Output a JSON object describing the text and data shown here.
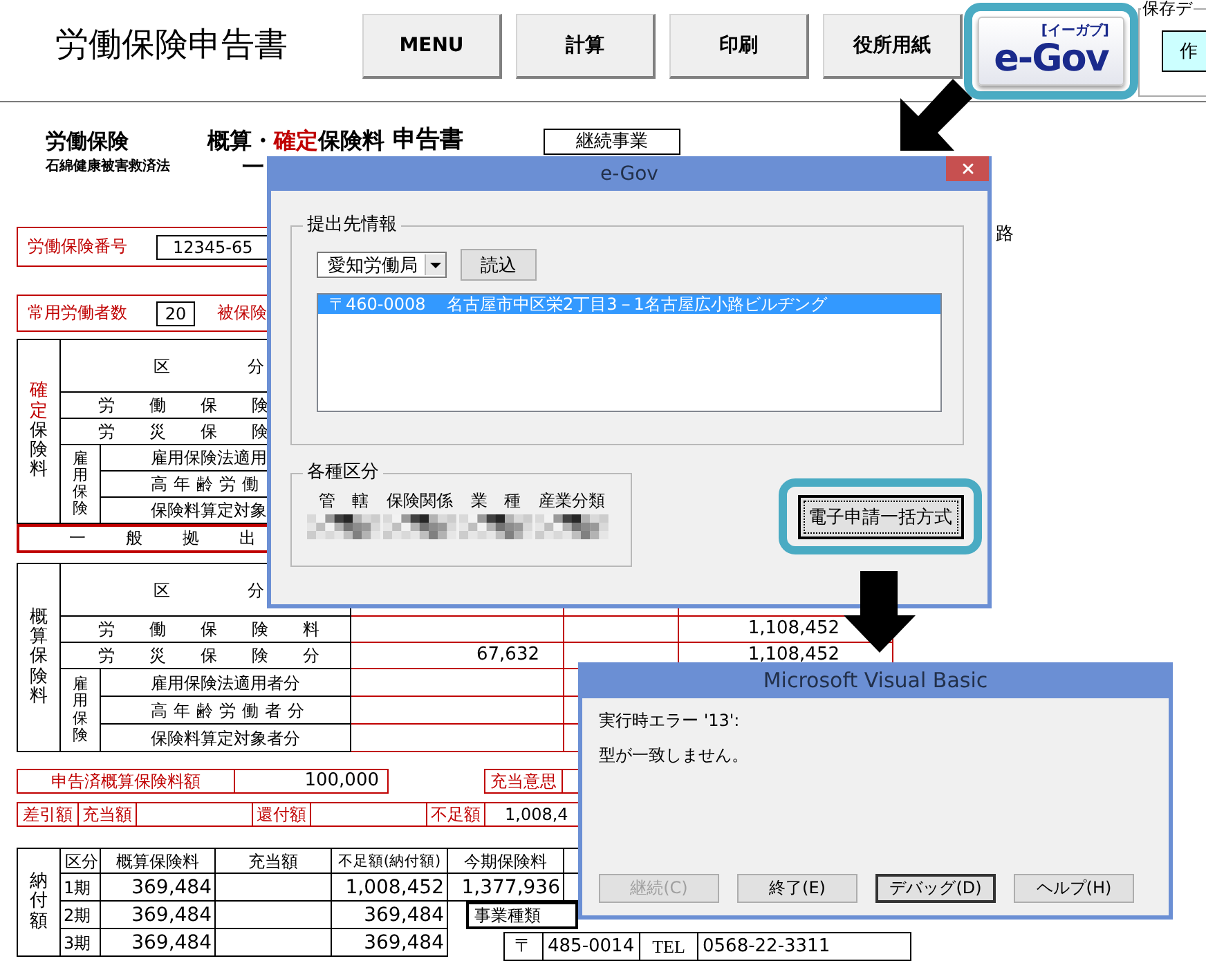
{
  "toolbar": {
    "title": "労働保険申告書",
    "buttons": [
      {
        "label": "MENU"
      },
      {
        "label": "計算"
      },
      {
        "label": "印刷"
      },
      {
        "label": "役所用紙"
      }
    ],
    "egov_button": {
      "ruby": "[イーガブ]",
      "logo": "e-Gov",
      "highlighted": true
    },
    "save_group": {
      "label": "保存デ",
      "button": "作"
    }
  },
  "form_heading": {
    "left": "労働保険",
    "left_sub": "石綿健康被害救済法",
    "title_parts": [
      {
        "text": "概算・",
        "kind": "plain"
      },
      {
        "text": "確定",
        "kind": "accent"
      },
      {
        "text": "保険料",
        "kind": "plain"
      }
    ],
    "title_fragment": "一",
    "suffix": "申告書",
    "badge": "継続事業"
  },
  "margin_fragment": "路",
  "insurance_number": {
    "label": "労働保険番号",
    "value": "12345-65"
  },
  "workers": {
    "label": "常用労働者数",
    "value": "20",
    "next_label": "被保険"
  },
  "kakutei_table": {
    "side_parts": [
      {
        "text": "確定",
        "kind": "accent"
      },
      {
        "text": "保険料",
        "kind": "plain"
      }
    ],
    "header": "区分",
    "rows": [
      {
        "label": "労働保険"
      },
      {
        "label": "労災保険"
      }
    ],
    "employment_group": {
      "label": "雇用保険",
      "rows": [
        {
          "label": "雇用保険法適用"
        },
        {
          "label": "高年齢労働"
        },
        {
          "label": "保険料算定対象"
        }
      ]
    },
    "general": "一般拠出"
  },
  "gaisan_table": {
    "side_label": "概算保険料",
    "header": "区分",
    "rows": [
      {
        "label": "労働保険料",
        "column_4": "1,108,452"
      },
      {
        "label": "労災保険分",
        "column_2": "67,632",
        "column_4": "1,108,452"
      }
    ],
    "employment_group": {
      "label": "雇用保険",
      "rows": [
        {
          "label": "雇用保険法適用者分"
        },
        {
          "label": "高年齢労働者分"
        },
        {
          "label": "保険料算定対象者分"
        }
      ]
    }
  },
  "declared": {
    "label": "申告済概算保険料額",
    "value": "100,000",
    "option_label": "充当意思"
  },
  "balance": [
    {
      "kind": "label",
      "text": "差引額"
    },
    {
      "kind": "label",
      "text": "充当額"
    },
    {
      "kind": "blank"
    },
    {
      "kind": "label",
      "text": "還付額"
    },
    {
      "kind": "blank"
    },
    {
      "kind": "label",
      "text": "不足額"
    },
    {
      "kind": "value",
      "text": "1,008,4"
    }
  ],
  "payment_table": {
    "side_label": "納付額",
    "columns": [
      "区分",
      "概算保険料",
      "充当額",
      "不足額(納付額)",
      "今期保険料"
    ],
    "rows": [
      {
        "period": "1期",
        "estimate": "369,484",
        "shortfall": "1,008,452",
        "current": "1,377,936"
      },
      {
        "period": "2期",
        "estimate": "369,484",
        "shortfall": "369,484"
      },
      {
        "period": "3期",
        "estimate": "369,484",
        "shortfall": "369,484"
      }
    ]
  },
  "business_type": {
    "label": "事業種類"
  },
  "address": {
    "postal_mark": "〒",
    "postcode": "485-0014",
    "tel_label": "TEL",
    "tel": "0568-22-3311"
  },
  "egov_dialog": {
    "title": "e-Gov",
    "submit_group": {
      "label": "提出先情報",
      "office": "愛知労働局",
      "load_button": "読込",
      "addresses": [
        {
          "text": "〒460-0008    名古屋市中区栄2丁目3－1名古屋広小路ビルヂング",
          "selected": true
        }
      ]
    },
    "category_group": {
      "label": "各種区分",
      "fields": [
        {
          "label": "管　轄"
        },
        {
          "label": "保険関係"
        },
        {
          "label": "業　種"
        },
        {
          "label": "産業分類"
        }
      ]
    },
    "batch_button": {
      "label": "電子申請一括方式",
      "highlighted": true
    }
  },
  "error_dialog": {
    "title": "Microsoft Visual Basic",
    "message": "実行時エラー '13':",
    "detail": "型が一致しません。",
    "buttons": [
      {
        "label": "継続(C)",
        "disabled": true,
        "focused": false
      },
      {
        "label": "終了(E)",
        "disabled": false,
        "focused": false
      },
      {
        "label": "デバッグ(D)",
        "disabled": false,
        "focused": true
      },
      {
        "label": "ヘルプ(H)",
        "disabled": false,
        "focused": false
      }
    ]
  }
}
